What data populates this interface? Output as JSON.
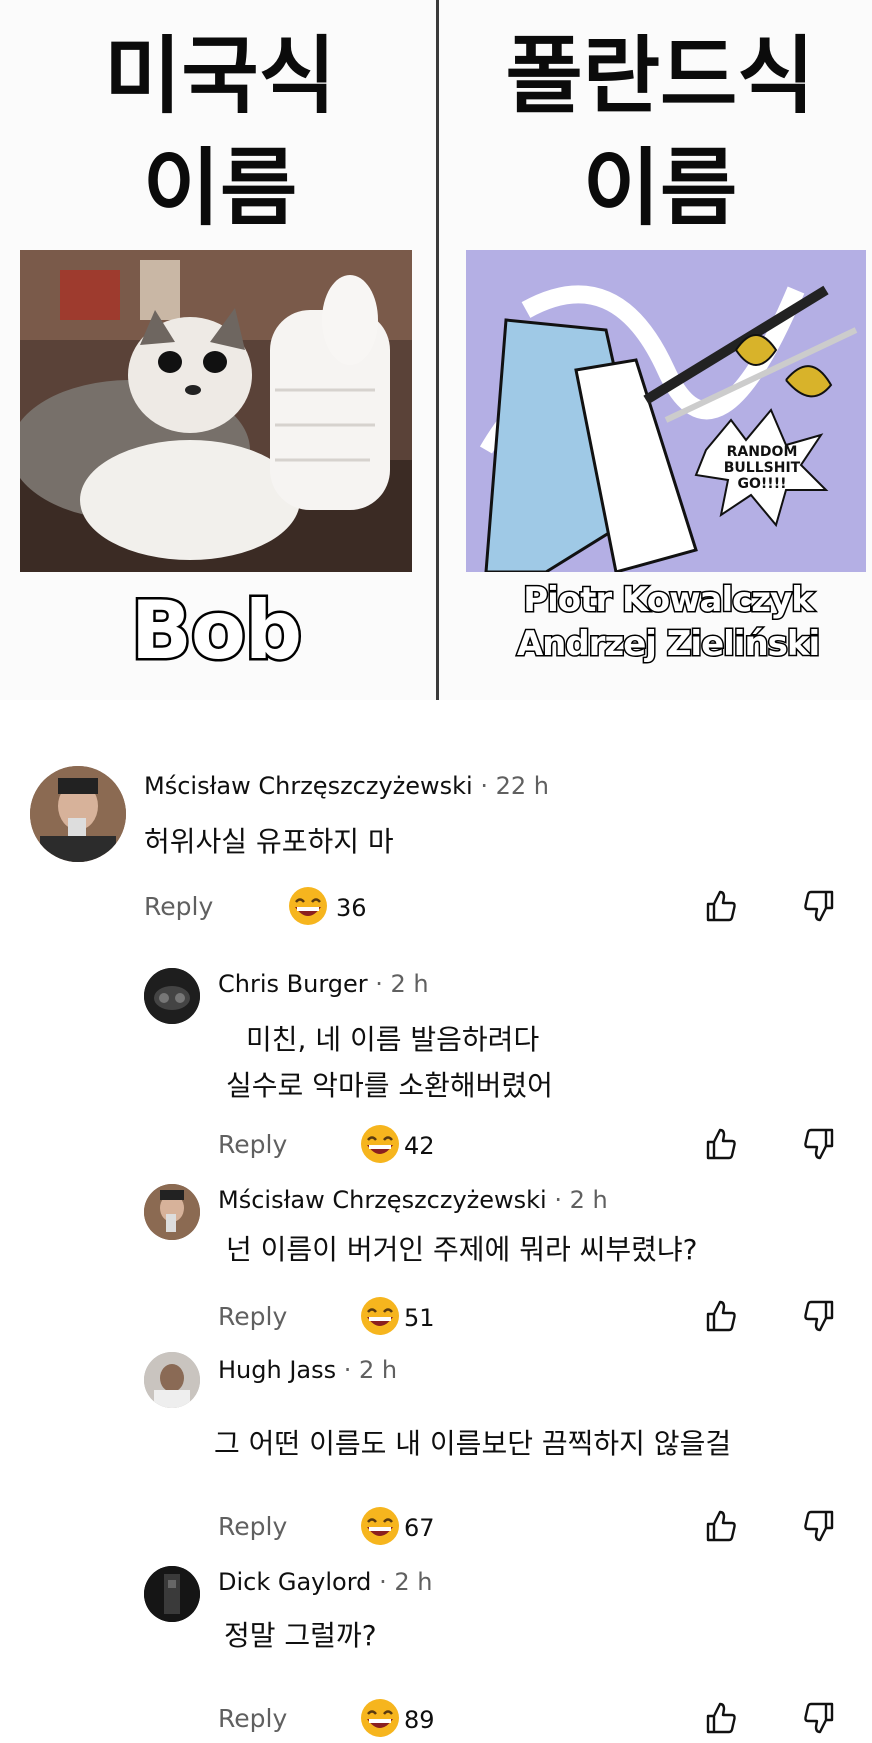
{
  "meme": {
    "left_title_line1": "미국식",
    "left_title_line2": "이름",
    "right_title_line1": "폴란드식",
    "right_title_line2": "이름",
    "left_caption": "Bob",
    "right_caption_line1": "Piotr Kowalczyk",
    "right_caption_line2": "Andrzej Zieliński",
    "comic_bubble": [
      "RANDOM",
      "BULLSHIT",
      "GO!!!!"
    ]
  },
  "comments": [
    {
      "author": "Mścisław Chrzęszczyżewski",
      "time": "22 h",
      "text": "허위사실 유포하지 마",
      "reply_label": "Reply",
      "reactions": "36"
    },
    {
      "author": "Chris Burger",
      "time": "2 h",
      "text_line1": "미친, 네 이름 발음하려다",
      "text_line2": "실수로 악마를 소환해버렸어",
      "reply_label": "Reply",
      "reactions": "42"
    },
    {
      "author": "Mścisław Chrzęszczyżewski",
      "time": "2 h",
      "text": "넌 이름이 버거인 주제에 뭐라 씨부렸냐?",
      "reply_label": "Reply",
      "reactions": "51"
    },
    {
      "author": "Hugh Jass",
      "time": "2 h",
      "text": "그 어떤 이름도 내 이름보단 끔찍하지 않을걸",
      "reply_label": "Reply",
      "reactions": "67"
    },
    {
      "author": "Dick Gaylord",
      "time": "2 h",
      "text": "정말 그럴까?",
      "reply_label": "Reply",
      "reactions": "89"
    }
  ],
  "colors": {
    "muted": "#606060",
    "text": "#0f0f0f",
    "divider": "#3a3a3a"
  }
}
